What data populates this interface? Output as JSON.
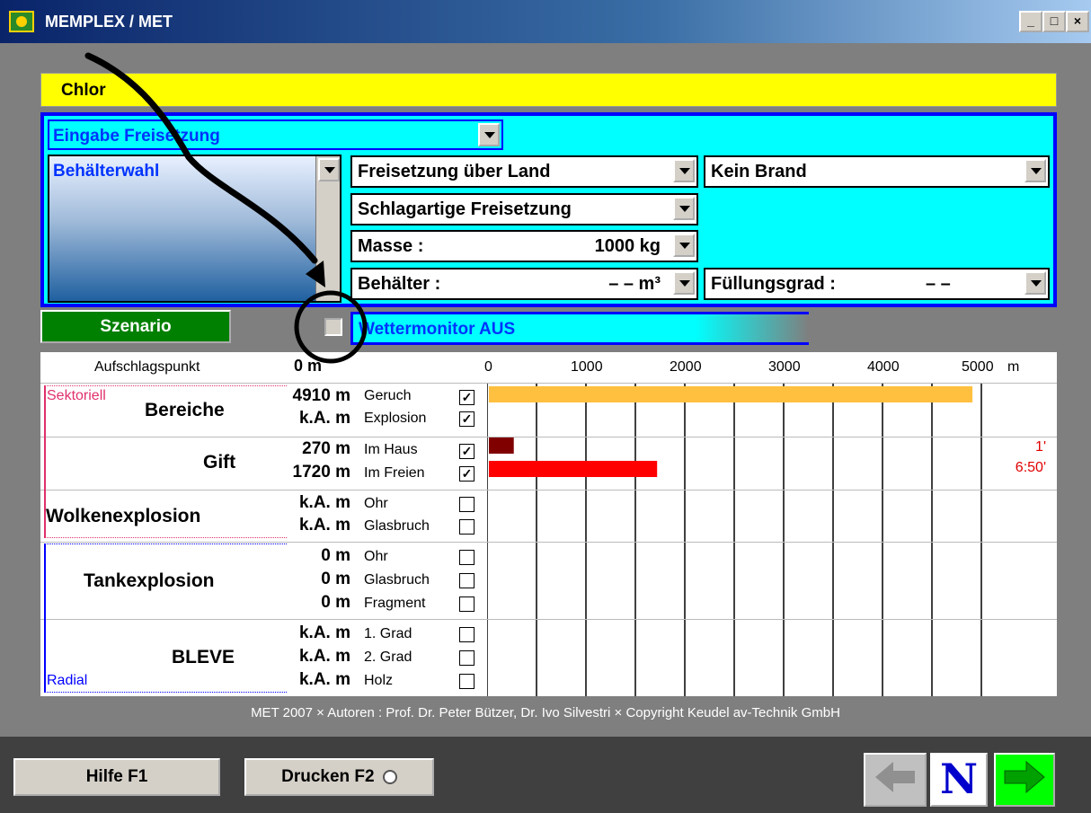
{
  "window": {
    "title": "MEMPLEX / MET",
    "controls": [
      "_",
      "□",
      "×"
    ]
  },
  "substance": "Chlor",
  "input": {
    "mode_select": "Eingabe Freisetzung",
    "container_list_label": "Behälterwahl",
    "release_location": "Freisetzung über Land",
    "fire": "Kein Brand",
    "release_type": "Schlagartige Freisetzung",
    "mass_label": "Masse :",
    "mass_value": "1000 kg",
    "container_label": "Behälter :",
    "container_value": "– – m³",
    "fill_label": "Füllungsgrad :",
    "fill_value": "– –"
  },
  "scenario_button": "Szenario",
  "weather_monitor": "Wettermonitor AUS",
  "results": {
    "impact_label": "Aufschlagspunkt",
    "impact_value": "0 m",
    "axis_ticks": [
      "0",
      "1000",
      "2000",
      "3000",
      "4000",
      "5000"
    ],
    "axis_unit": "m",
    "sector_label": "Sektoriell",
    "radial_label": "Radial",
    "groups": [
      {
        "name": "Bereiche",
        "rows": [
          {
            "dist": "4910 m",
            "label": "Geruch",
            "checked": true
          },
          {
            "dist": "k.A. m",
            "label": "Explosion",
            "checked": true
          }
        ]
      },
      {
        "name": "Gift",
        "rows": [
          {
            "dist": "270 m",
            "label": "Im Haus",
            "checked": true,
            "time": "1'"
          },
          {
            "dist": "1720 m",
            "label": "Im Freien",
            "checked": true,
            "time": "6:50'"
          }
        ]
      },
      {
        "name": "Wolkenexplosion",
        "rows": [
          {
            "dist": "k.A. m",
            "label": "Ohr",
            "checked": false
          },
          {
            "dist": "k.A. m",
            "label": "Glasbruch",
            "checked": false
          }
        ]
      },
      {
        "name": "Tankexplosion",
        "rows": [
          {
            "dist": "0 m",
            "label": "Ohr",
            "checked": false
          },
          {
            "dist": "0 m",
            "label": "Glasbruch",
            "checked": false
          },
          {
            "dist": "0 m",
            "label": "Fragment",
            "checked": false
          }
        ]
      },
      {
        "name": "BLEVE",
        "rows": [
          {
            "dist": "k.A. m",
            "label": "1. Grad",
            "checked": false
          },
          {
            "dist": "k.A. m",
            "label": "2. Grad",
            "checked": false
          },
          {
            "dist": "k.A. m",
            "label": "Holz",
            "checked": false
          }
        ]
      }
    ]
  },
  "chart_data": {
    "type": "bar",
    "categories": [
      "Geruch",
      "Im Haus",
      "Im Freien"
    ],
    "values": [
      4910,
      270,
      1720
    ],
    "xlim": [
      0,
      5000
    ],
    "colors": [
      "#ffc040",
      "#800000",
      "#ff0000"
    ]
  },
  "footer": "MET  2007 × Autoren : Prof. Dr. Peter Bützer,  Dr. Ivo Silvestri × Copyright Keudel av-Technik GmbH",
  "buttons": {
    "help": "Hilfe F1",
    "print": "Drucken F2",
    "nav_n": "N"
  }
}
